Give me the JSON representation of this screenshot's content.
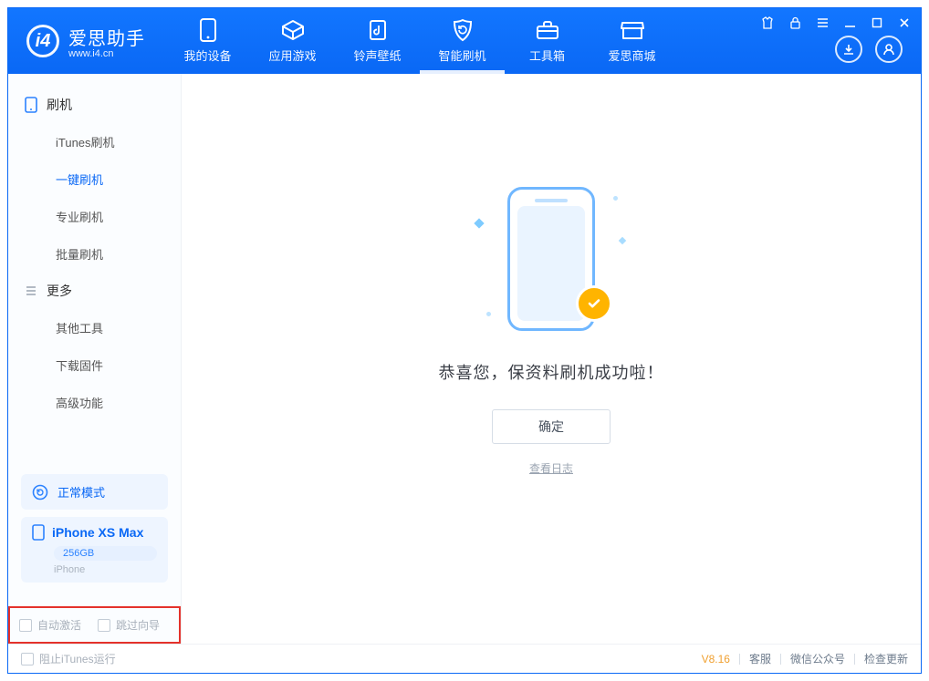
{
  "app": {
    "name_cn": "爱思助手",
    "name_en": "www.i4.cn"
  },
  "tabs": [
    {
      "label": "我的设备"
    },
    {
      "label": "应用游戏"
    },
    {
      "label": "铃声壁纸"
    },
    {
      "label": "智能刷机"
    },
    {
      "label": "工具箱"
    },
    {
      "label": "爱思商城"
    }
  ],
  "sidebar": {
    "group1_title": "刷机",
    "group1_items": [
      {
        "label": "iTunes刷机"
      },
      {
        "label": "一键刷机"
      },
      {
        "label": "专业刷机"
      },
      {
        "label": "批量刷机"
      }
    ],
    "group2_title": "更多",
    "group2_items": [
      {
        "label": "其他工具"
      },
      {
        "label": "下载固件"
      },
      {
        "label": "高级功能"
      }
    ],
    "status_label": "正常模式",
    "device": {
      "name": "iPhone XS Max",
      "storage": "256GB",
      "type": "iPhone"
    },
    "opt_auto_activate": "自动激活",
    "opt_skip_guide": "跳过向导"
  },
  "main": {
    "message": "恭喜您，保资料刷机成功啦！",
    "ok_label": "确定",
    "log_link": "查看日志"
  },
  "footer": {
    "block_itunes": "阻止iTunes运行",
    "version": "V8.16",
    "link_service": "客服",
    "link_wechat": "微信公众号",
    "link_update": "检查更新"
  }
}
